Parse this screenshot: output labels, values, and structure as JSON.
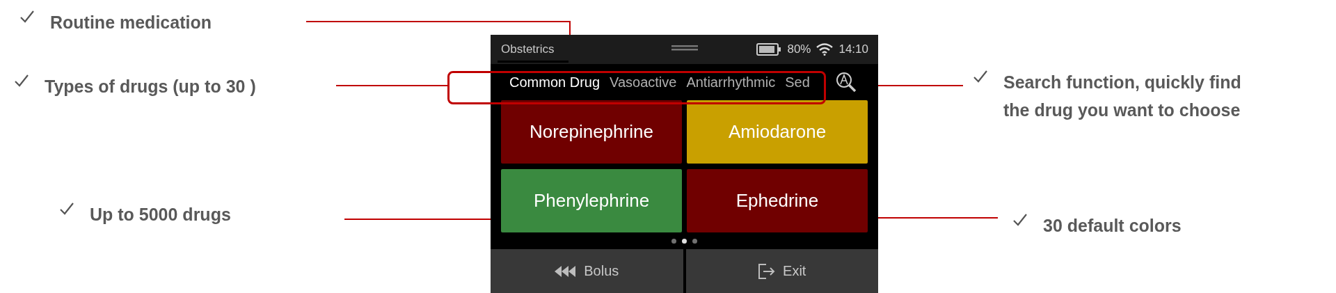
{
  "annotations": [
    {
      "text": "Routine medication",
      "kind": "tabs-area"
    },
    {
      "text": "Types of drugs (up to 30 )",
      "kind": "tabs"
    },
    {
      "text": "Up to 5000 drugs",
      "kind": "tiles"
    },
    {
      "text": "Search function, quickly find the drug you want to choose",
      "kind": "search"
    },
    {
      "text": "30 default colors",
      "kind": "colors"
    }
  ],
  "device": {
    "status_bar": {
      "title": "Obstetrics",
      "battery": "80%",
      "time": "14:10"
    },
    "tabs": [
      {
        "label": "Common Drug",
        "selected": true
      },
      {
        "label": "Vasoactive",
        "selected": false
      },
      {
        "label": "Antiarrhythmic",
        "selected": false
      },
      {
        "label": "Sed",
        "selected": false
      }
    ],
    "drugs": [
      {
        "name": "Norepinephrine",
        "color": "#700000"
      },
      {
        "name": "Amiodarone",
        "color": "#c9a000"
      },
      {
        "name": "Phenylephrine",
        "color": "#3a8a40"
      },
      {
        "name": "Ephedrine",
        "color": "#700000"
      }
    ],
    "pages": [
      {
        "selected": false
      },
      {
        "selected": true
      },
      {
        "selected": false
      }
    ],
    "buttons": [
      {
        "label": "Bolus",
        "kind": "bolus"
      },
      {
        "label": "Exit",
        "kind": "exit"
      }
    ]
  }
}
